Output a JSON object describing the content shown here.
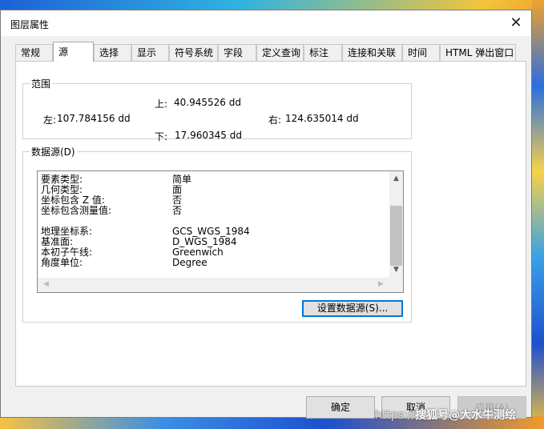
{
  "dialog": {
    "title": "图层属性",
    "close_glyph": "✕"
  },
  "tabs": [
    {
      "label": "常规"
    },
    {
      "label": "源",
      "active": true
    },
    {
      "label": "选择"
    },
    {
      "label": "显示"
    },
    {
      "label": "符号系统"
    },
    {
      "label": "字段"
    },
    {
      "label": "定义查询"
    },
    {
      "label": "标注"
    },
    {
      "label": "连接和关联"
    },
    {
      "label": "时间"
    },
    {
      "label": "HTML 弹出窗口"
    }
  ],
  "extent": {
    "title": "范围",
    "top_label": "上:",
    "top_value": "40.945526 dd",
    "left_label": "左:",
    "left_value": "107.784156 dd",
    "right_label": "右:",
    "right_value": "124.635014 dd",
    "bottom_label": "下:",
    "bottom_value": "17.960345 dd"
  },
  "datasource": {
    "title": "数据源(D)",
    "rows": [
      {
        "key": "要素类型:",
        "value": "简单"
      },
      {
        "key": "几何类型:",
        "value": "面"
      },
      {
        "key": "坐标包含 Z 值:",
        "value": "否"
      },
      {
        "key": "坐标包含测量值:",
        "value": "否"
      },
      {
        "key": "",
        "value": ""
      },
      {
        "key": "地理坐标系:",
        "value": "GCS_WGS_1984"
      },
      {
        "key": "基准面:",
        "value": "D_WGS_1984"
      },
      {
        "key": "本初子午线:",
        "value": "Greenwich"
      },
      {
        "key": "角度单位:",
        "value": "Degree"
      }
    ],
    "set_button": "设置数据源(S)..."
  },
  "buttons": {
    "ok": "确定",
    "cancel": "取消",
    "apply": "应用(A)"
  },
  "watermark": {
    "text": "搜狐号@大水牛测绘",
    "prefix": "https://"
  },
  "icons": {
    "up": "▲",
    "down": "▼",
    "left": "◀",
    "right": "▶"
  }
}
